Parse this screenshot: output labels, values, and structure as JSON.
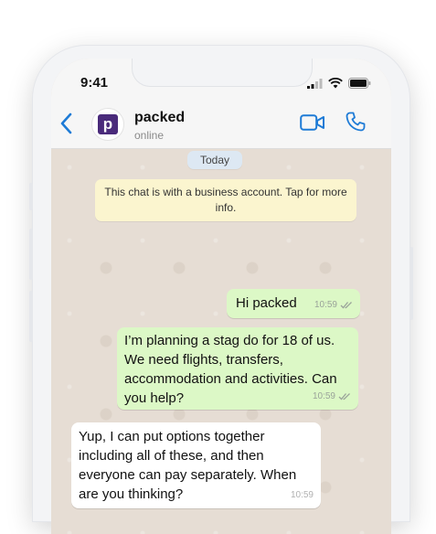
{
  "status_bar": {
    "time": "9:41"
  },
  "header": {
    "contact_name": "packed",
    "contact_status": "online",
    "avatar_letter": "p"
  },
  "chat": {
    "date_label": "Today",
    "system_message": "This chat is with a business account. Tap for more info.",
    "messages": [
      {
        "direction": "outgoing",
        "text": "Hi packed",
        "time": "10:59"
      },
      {
        "direction": "outgoing",
        "text": "I’m planning a stag do for 18 of us. We need flights, transfers, accommodation and activities. Can you help?",
        "time": "10:59"
      },
      {
        "direction": "incoming",
        "text": "Yup, I can put options together including all of these, and then everyone can pay separately. When are you thinking?",
        "time": "10:59"
      }
    ]
  },
  "colors": {
    "accent": "#1e7bd6",
    "outgoing_bubble": "#dcf8c6",
    "incoming_bubble": "#ffffff",
    "chat_background": "#e6ddd4",
    "brand": "#4a2b7b"
  }
}
